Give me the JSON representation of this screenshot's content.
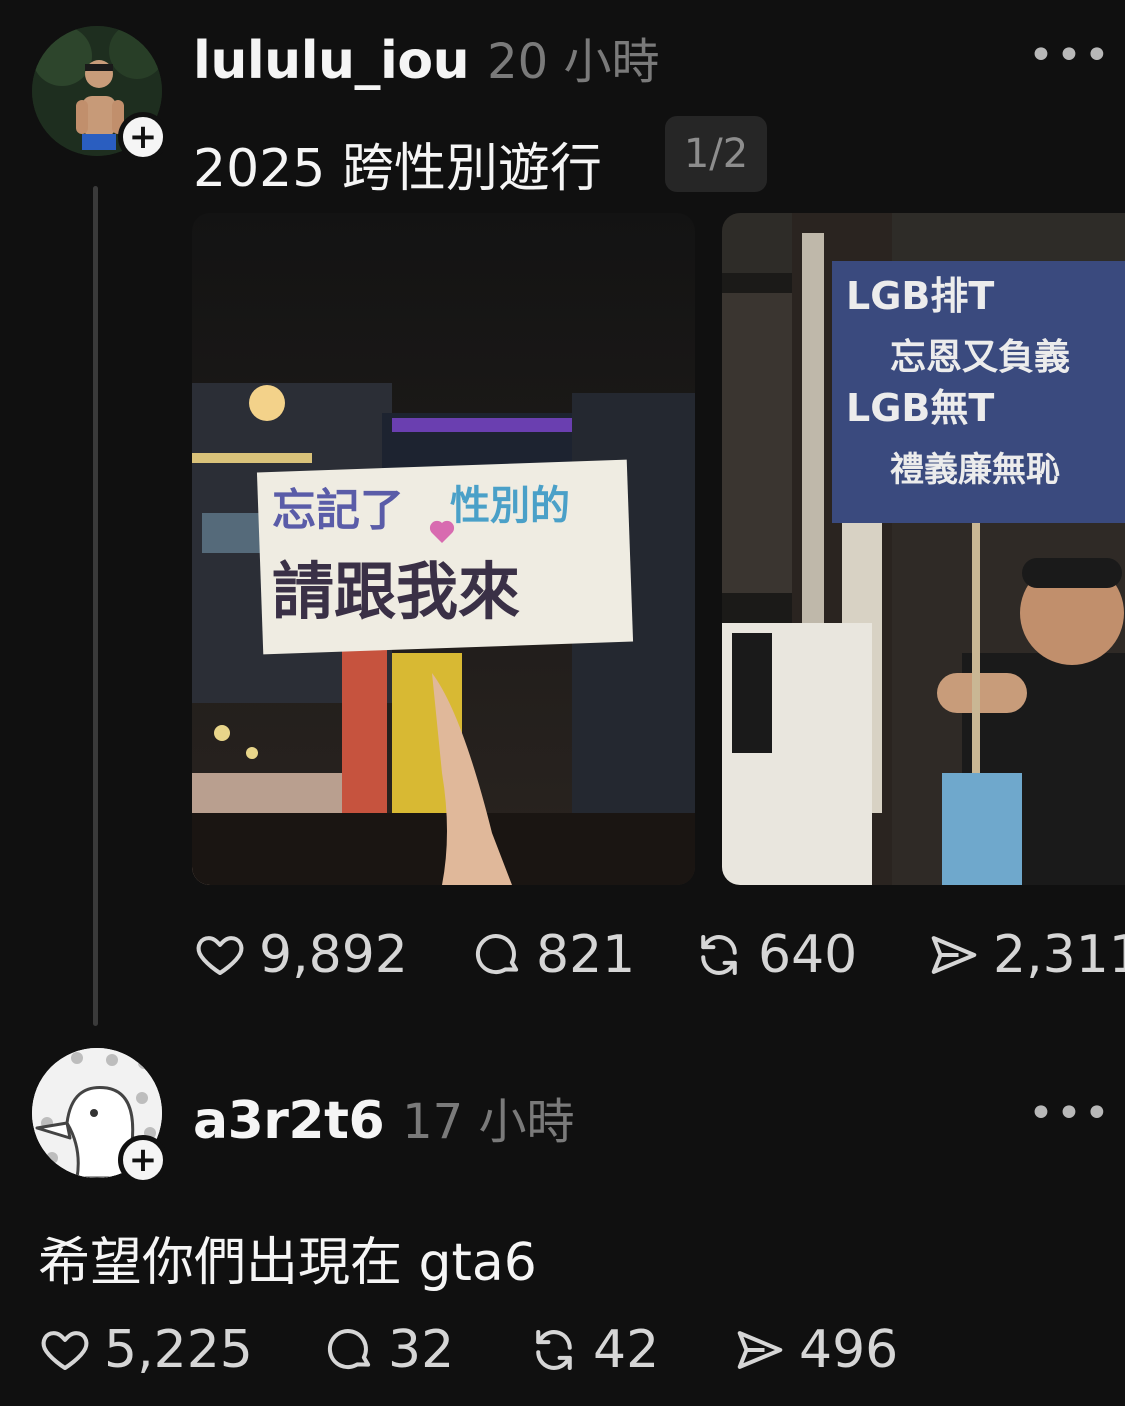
{
  "post": {
    "username": "lululu_iou",
    "time": "20 小時",
    "more_label": "•••",
    "text": "2025 跨性別遊行",
    "page_badge": "1/2",
    "images": [
      {
        "sign_line1_a": "忘記了",
        "sign_line1_b": "性別的",
        "sign_line2": "請跟我來"
      },
      {
        "sign_line1": "LGB排T",
        "sign_line2": "忘恩又負義",
        "sign_line3": "LGB無T",
        "sign_line4": "禮義廉無恥"
      }
    ],
    "actions": {
      "likes": "9,892",
      "comments": "821",
      "reposts": "640",
      "shares": "2,311"
    }
  },
  "reply": {
    "username": "a3r2t6",
    "time": "17 小時",
    "more_label": "•••",
    "text": "希望你們出現在 gta6",
    "actions": {
      "likes": "5,225",
      "comments": "32",
      "reposts": "42",
      "shares": "496"
    }
  },
  "colors": {
    "background": "#101010",
    "text_primary": "#f5f5f5",
    "text_secondary": "#7a7a7a",
    "thread_line": "#3a3a3a"
  }
}
